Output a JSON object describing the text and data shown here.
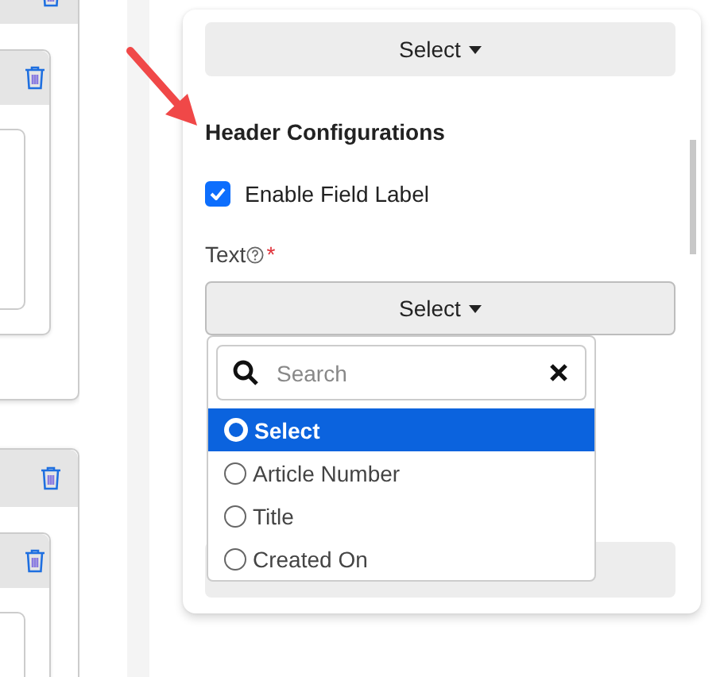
{
  "panel": {
    "top_select": {
      "label": "Select"
    },
    "heading": "Header Configurations",
    "enable_field_label": {
      "label": "Enable Field Label",
      "checked": true
    },
    "text_field": {
      "label": "Text",
      "required": true,
      "required_mark": "*",
      "select": {
        "label": "Select"
      },
      "dropdown": {
        "search": {
          "placeholder": "Search"
        },
        "options": [
          {
            "label": "Select",
            "selected": true
          },
          {
            "label": "Article Number",
            "selected": false
          },
          {
            "label": "Title",
            "selected": false
          },
          {
            "label": "Created On",
            "selected": false
          }
        ]
      }
    }
  }
}
